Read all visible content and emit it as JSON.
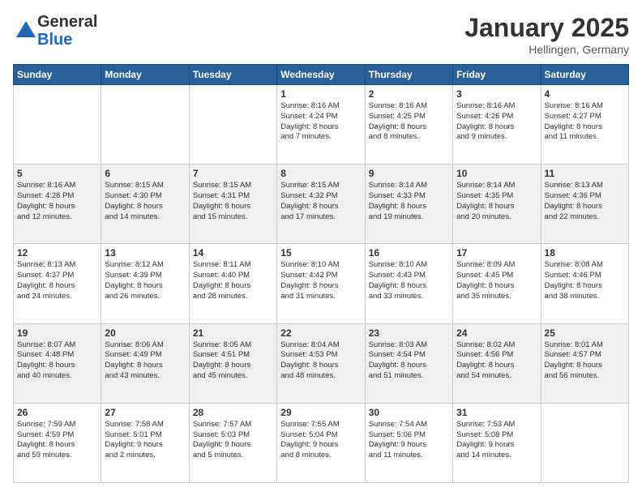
{
  "logo": {
    "general": "General",
    "blue": "Blue"
  },
  "title": "January 2025",
  "location": "Hellingen, Germany",
  "weekdays": [
    "Sunday",
    "Monday",
    "Tuesday",
    "Wednesday",
    "Thursday",
    "Friday",
    "Saturday"
  ],
  "weeks": [
    [
      {
        "day": "",
        "info": ""
      },
      {
        "day": "",
        "info": ""
      },
      {
        "day": "",
        "info": ""
      },
      {
        "day": "1",
        "info": "Sunrise: 8:16 AM\nSunset: 4:24 PM\nDaylight: 8 hours\nand 7 minutes."
      },
      {
        "day": "2",
        "info": "Sunrise: 8:16 AM\nSunset: 4:25 PM\nDaylight: 8 hours\nand 8 minutes."
      },
      {
        "day": "3",
        "info": "Sunrise: 8:16 AM\nSunset: 4:26 PM\nDaylight: 8 hours\nand 9 minutes."
      },
      {
        "day": "4",
        "info": "Sunrise: 8:16 AM\nSunset: 4:27 PM\nDaylight: 8 hours\nand 11 minutes."
      }
    ],
    [
      {
        "day": "5",
        "info": "Sunrise: 8:16 AM\nSunset: 4:28 PM\nDaylight: 8 hours\nand 12 minutes."
      },
      {
        "day": "6",
        "info": "Sunrise: 8:15 AM\nSunset: 4:30 PM\nDaylight: 8 hours\nand 14 minutes."
      },
      {
        "day": "7",
        "info": "Sunrise: 8:15 AM\nSunset: 4:31 PM\nDaylight: 8 hours\nand 15 minutes."
      },
      {
        "day": "8",
        "info": "Sunrise: 8:15 AM\nSunset: 4:32 PM\nDaylight: 8 hours\nand 17 minutes."
      },
      {
        "day": "9",
        "info": "Sunrise: 8:14 AM\nSunset: 4:33 PM\nDaylight: 8 hours\nand 19 minutes."
      },
      {
        "day": "10",
        "info": "Sunrise: 8:14 AM\nSunset: 4:35 PM\nDaylight: 8 hours\nand 20 minutes."
      },
      {
        "day": "11",
        "info": "Sunrise: 8:13 AM\nSunset: 4:36 PM\nDaylight: 8 hours\nand 22 minutes."
      }
    ],
    [
      {
        "day": "12",
        "info": "Sunrise: 8:13 AM\nSunset: 4:37 PM\nDaylight: 8 hours\nand 24 minutes."
      },
      {
        "day": "13",
        "info": "Sunrise: 8:12 AM\nSunset: 4:39 PM\nDaylight: 8 hours\nand 26 minutes."
      },
      {
        "day": "14",
        "info": "Sunrise: 8:11 AM\nSunset: 4:40 PM\nDaylight: 8 hours\nand 28 minutes."
      },
      {
        "day": "15",
        "info": "Sunrise: 8:10 AM\nSunset: 4:42 PM\nDaylight: 8 hours\nand 31 minutes."
      },
      {
        "day": "16",
        "info": "Sunrise: 8:10 AM\nSunset: 4:43 PM\nDaylight: 8 hours\nand 33 minutes."
      },
      {
        "day": "17",
        "info": "Sunrise: 8:09 AM\nSunset: 4:45 PM\nDaylight: 8 hours\nand 35 minutes."
      },
      {
        "day": "18",
        "info": "Sunrise: 8:08 AM\nSunset: 4:46 PM\nDaylight: 8 hours\nand 38 minutes."
      }
    ],
    [
      {
        "day": "19",
        "info": "Sunrise: 8:07 AM\nSunset: 4:48 PM\nDaylight: 8 hours\nand 40 minutes."
      },
      {
        "day": "20",
        "info": "Sunrise: 8:06 AM\nSunset: 4:49 PM\nDaylight: 8 hours\nand 43 minutes."
      },
      {
        "day": "21",
        "info": "Sunrise: 8:05 AM\nSunset: 4:51 PM\nDaylight: 8 hours\nand 45 minutes."
      },
      {
        "day": "22",
        "info": "Sunrise: 8:04 AM\nSunset: 4:53 PM\nDaylight: 8 hours\nand 48 minutes."
      },
      {
        "day": "23",
        "info": "Sunrise: 8:03 AM\nSunset: 4:54 PM\nDaylight: 8 hours\nand 51 minutes."
      },
      {
        "day": "24",
        "info": "Sunrise: 8:02 AM\nSunset: 4:56 PM\nDaylight: 8 hours\nand 54 minutes."
      },
      {
        "day": "25",
        "info": "Sunrise: 8:01 AM\nSunset: 4:57 PM\nDaylight: 8 hours\nand 56 minutes."
      }
    ],
    [
      {
        "day": "26",
        "info": "Sunrise: 7:59 AM\nSunset: 4:59 PM\nDaylight: 8 hours\nand 59 minutes."
      },
      {
        "day": "27",
        "info": "Sunrise: 7:58 AM\nSunset: 5:01 PM\nDaylight: 9 hours\nand 2 minutes."
      },
      {
        "day": "28",
        "info": "Sunrise: 7:57 AM\nSunset: 5:03 PM\nDaylight: 9 hours\nand 5 minutes."
      },
      {
        "day": "29",
        "info": "Sunrise: 7:55 AM\nSunset: 5:04 PM\nDaylight: 9 hours\nand 8 minutes."
      },
      {
        "day": "30",
        "info": "Sunrise: 7:54 AM\nSunset: 5:06 PM\nDaylight: 9 hours\nand 11 minutes."
      },
      {
        "day": "31",
        "info": "Sunrise: 7:53 AM\nSunset: 5:08 PM\nDaylight: 9 hours\nand 14 minutes."
      },
      {
        "day": "",
        "info": ""
      }
    ]
  ]
}
